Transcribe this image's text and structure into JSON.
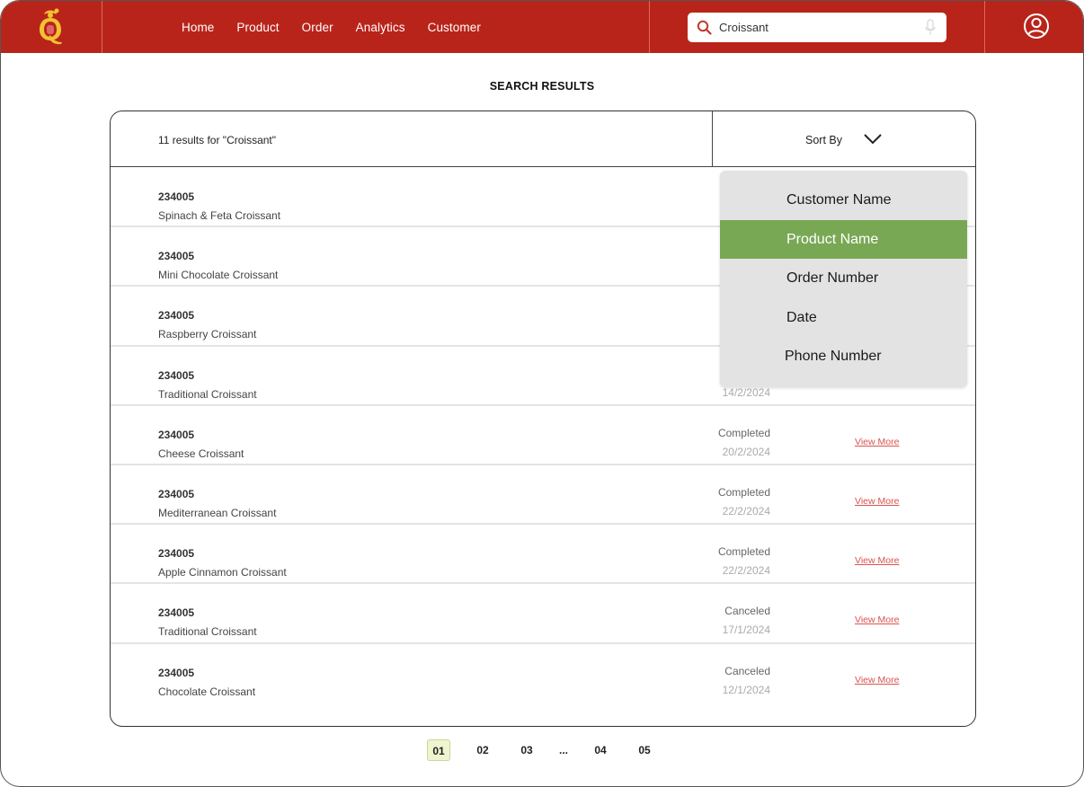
{
  "topbar": {
    "nav": [
      "Home",
      "Product",
      "Order",
      "Analytics",
      "Customer"
    ],
    "search": {
      "value": "Croissant"
    },
    "brand_color": "#b9241a"
  },
  "main": {
    "title": "SEARCH RESULTS",
    "results_count": "11 results for \"Croissant\"",
    "sort_label": "Sort By"
  },
  "rows": [
    {
      "id": "234005",
      "name": "Spinach & Feta Croissant",
      "status": "",
      "date": "",
      "link": ""
    },
    {
      "id": "234005",
      "name": "Mini Chocolate Croissant",
      "status": "",
      "date": "",
      "link": ""
    },
    {
      "id": "234005",
      "name": "Raspberry Croissant",
      "status": "",
      "date": "",
      "link": ""
    },
    {
      "id": "234005",
      "name": "Traditional Croissant",
      "status": "",
      "date": "14/2/2024",
      "link": ""
    },
    {
      "id": "234005",
      "name": "Cheese Croissant",
      "status": "Completed",
      "date": "20/2/2024",
      "link": "View More"
    },
    {
      "id": "234005",
      "name": "Mediterranean Croissant",
      "status": "Completed",
      "date": "22/2/2024",
      "link": "View More"
    },
    {
      "id": "234005",
      "name": "Apple Cinnamon Croissant",
      "status": "Completed",
      "date": "22/2/2024",
      "link": "View More"
    },
    {
      "id": "234005",
      "name": "Traditional Croissant",
      "status": "Canceled",
      "date": "17/1/2024",
      "link": "View More"
    },
    {
      "id": "234005",
      "name": "Chocolate Croissant",
      "status": "Canceled",
      "date": "12/1/2024",
      "link": "View More"
    }
  ],
  "sort_dropdown": {
    "options": [
      "Customer Name",
      "Product Name",
      "Order Number",
      "Date",
      "Phone Number"
    ],
    "selected": "Product Name",
    "selected_color": "#79a854"
  },
  "pagination": {
    "pages": [
      "01",
      "02",
      "03",
      "...",
      "04",
      "05"
    ],
    "current": "01"
  }
}
